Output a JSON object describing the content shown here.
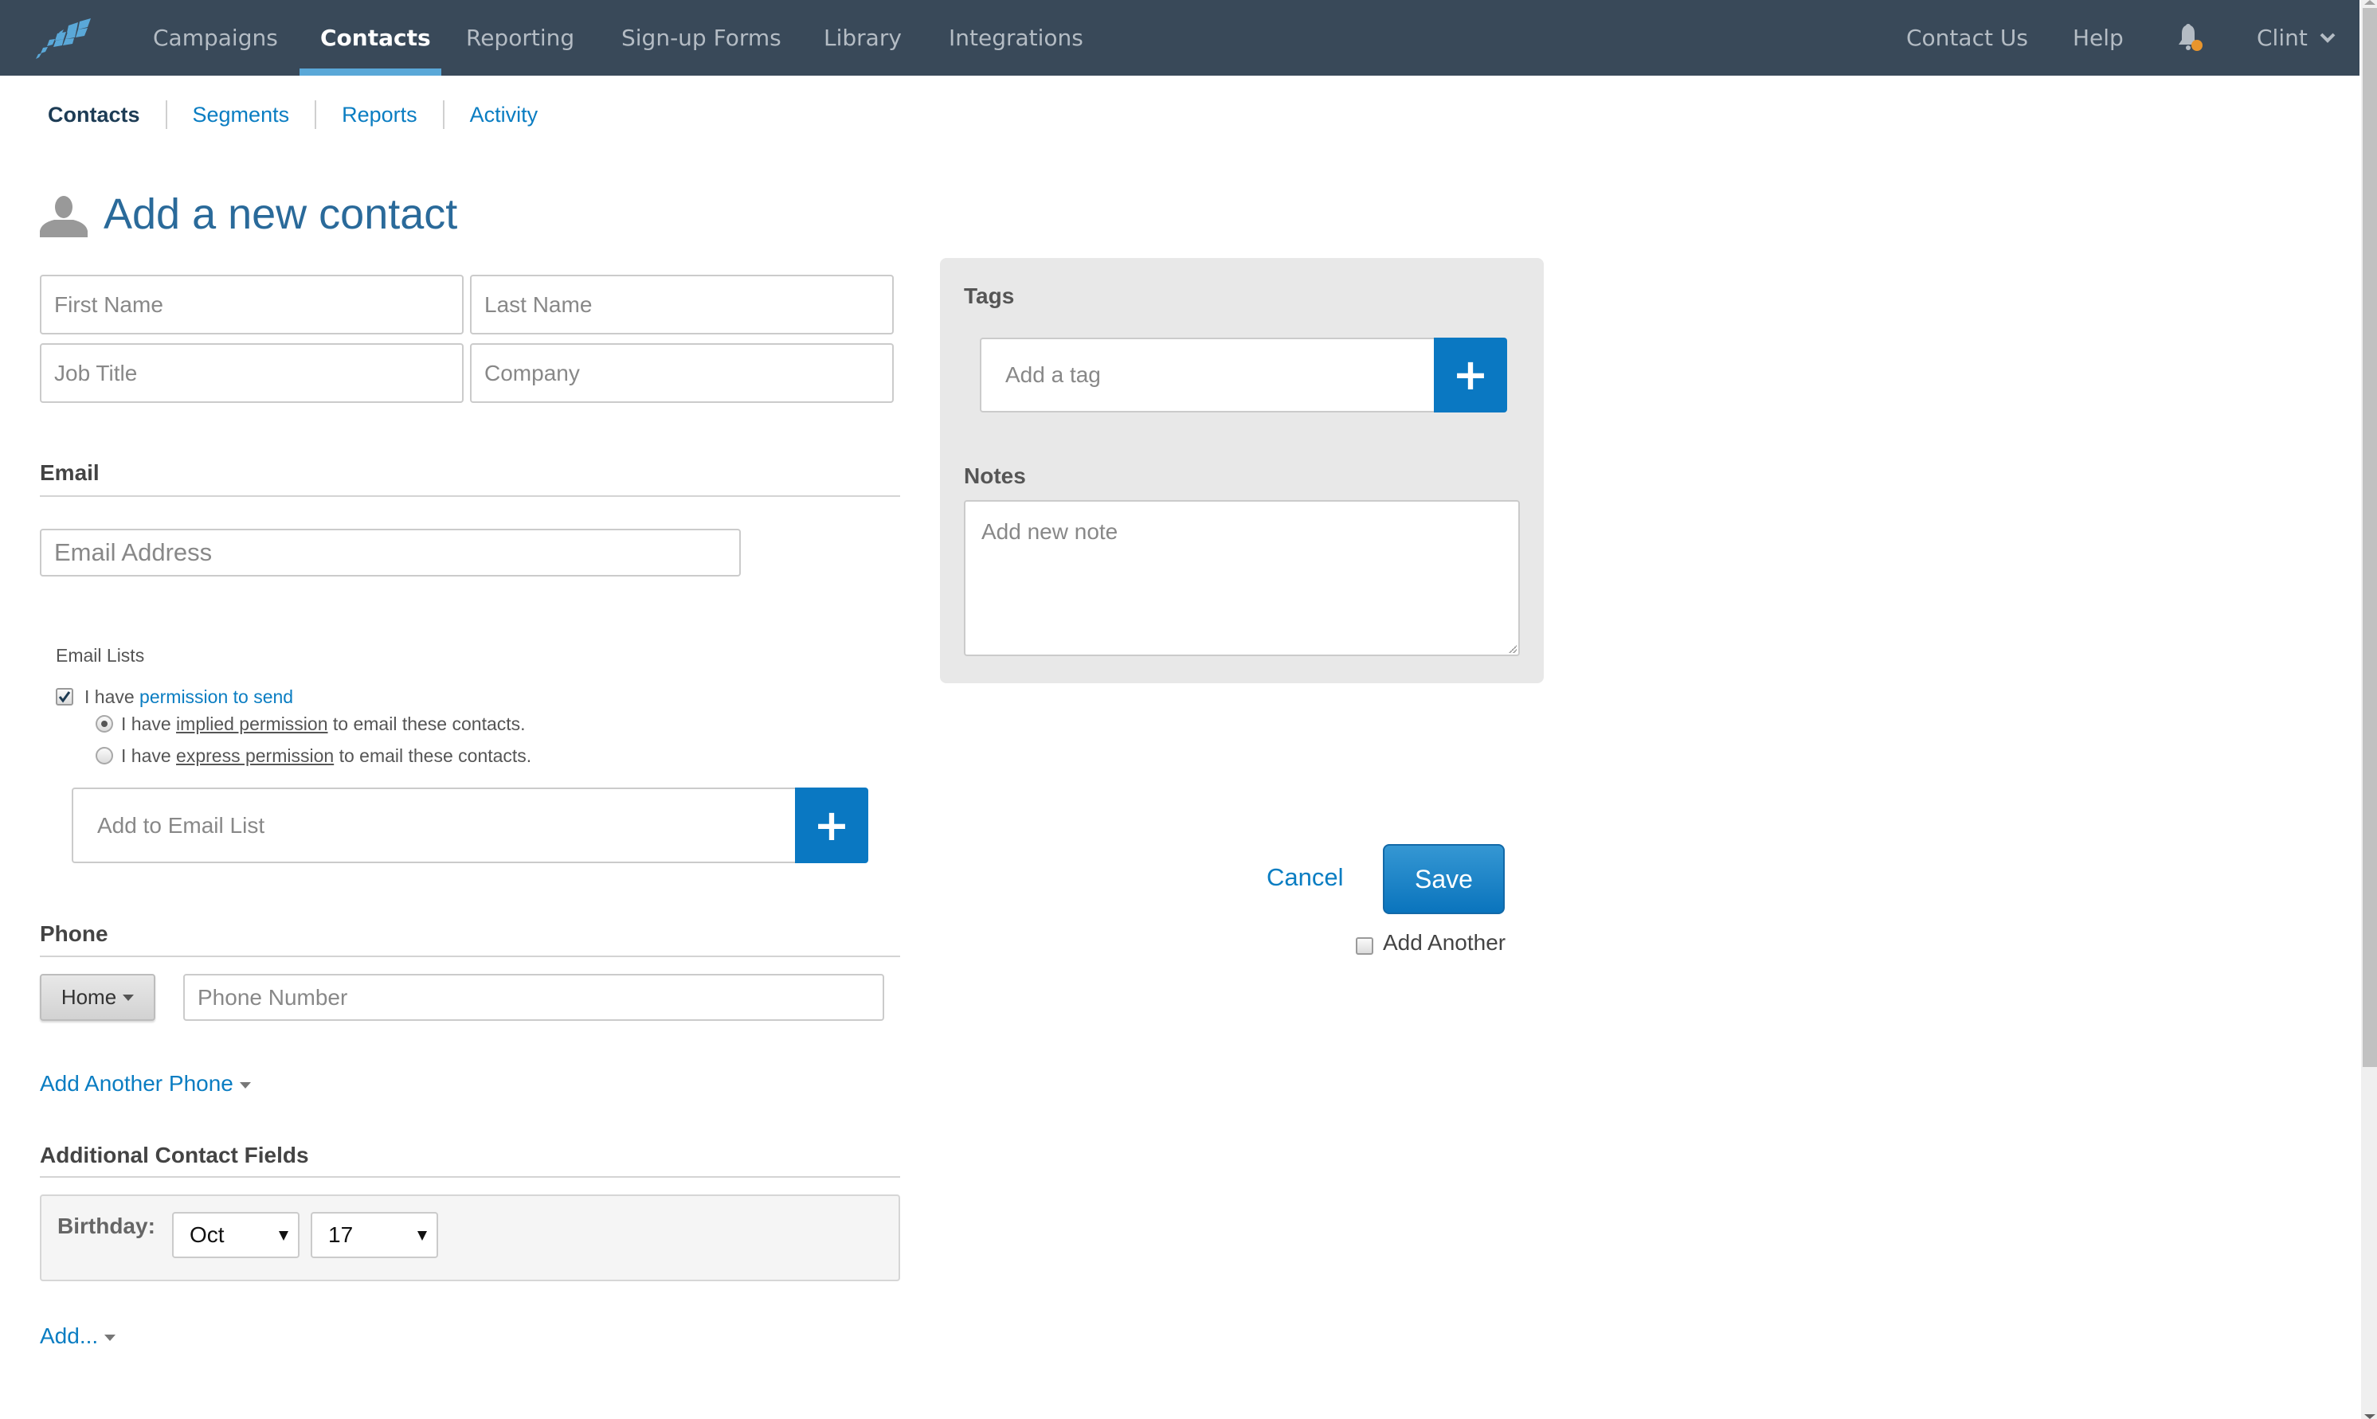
{
  "topnav": {
    "logo": "constant-contact-logo",
    "items": [
      {
        "label": "Campaigns",
        "active": false
      },
      {
        "label": "Contacts",
        "active": true
      },
      {
        "label": "Reporting",
        "active": false
      },
      {
        "label": "Sign-up Forms",
        "active": false
      },
      {
        "label": "Library",
        "active": false
      },
      {
        "label": "Integrations",
        "active": false
      }
    ],
    "right": {
      "contact_us": "Contact Us",
      "help": "Help",
      "notification_icon": "bell-icon",
      "notification_badge_color": "#e8952d",
      "user": "Clint"
    },
    "active_underline_color": "#5aa8d8",
    "bg_color": "#394959"
  },
  "subnav": {
    "items": [
      {
        "label": "Contacts",
        "active": true
      },
      {
        "label": "Segments",
        "active": false
      },
      {
        "label": "Reports",
        "active": false
      },
      {
        "label": "Activity",
        "active": false
      }
    ]
  },
  "page": {
    "title": "Add a new contact",
    "title_icon": "person-icon"
  },
  "name_fields": {
    "first_name": {
      "placeholder": "First Name",
      "value": ""
    },
    "last_name": {
      "placeholder": "Last Name",
      "value": ""
    },
    "job_title": {
      "placeholder": "Job Title",
      "value": ""
    },
    "company": {
      "placeholder": "Company",
      "value": ""
    }
  },
  "email": {
    "heading": "Email",
    "address": {
      "placeholder": "Email Address",
      "value": ""
    },
    "lists_label": "Email Lists",
    "permission": {
      "checked": true,
      "prefix": "I have ",
      "link": "permission to send"
    },
    "radios": [
      {
        "selected": true,
        "prefix": "I have ",
        "term": "implied permission",
        "suffix": " to email these contacts."
      },
      {
        "selected": false,
        "prefix": "I have ",
        "term": "express permission",
        "suffix": " to email these contacts."
      }
    ],
    "add_list": {
      "placeholder": "Add to Email List",
      "button_icon": "plus-icon"
    }
  },
  "phone": {
    "heading": "Phone",
    "type": "Home",
    "number": {
      "placeholder": "Phone Number",
      "value": ""
    },
    "add_another": "Add Another Phone"
  },
  "additional": {
    "heading": "Additional Contact Fields",
    "birthday_label": "Birthday:",
    "birthday_month": "Oct",
    "birthday_day": "17",
    "add_link": "Add..."
  },
  "side_panel": {
    "tags_label": "Tags",
    "tag_input": {
      "placeholder": "Add a tag",
      "button_icon": "plus-icon"
    },
    "notes_label": "Notes",
    "notes": {
      "placeholder": "Add new note",
      "value": ""
    }
  },
  "actions": {
    "cancel": "Cancel",
    "save": "Save",
    "add_another": "Add Another",
    "add_another_checked": false
  },
  "colors": {
    "primary_blue": "#0a78c2",
    "link_blue": "#0a7dc2",
    "title_blue": "#2a6a9a"
  }
}
